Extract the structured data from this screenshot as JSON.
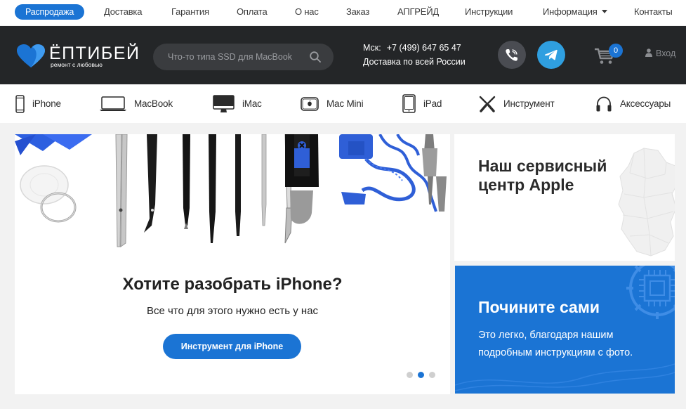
{
  "topnav": {
    "sale": "Распродажа",
    "items": [
      "Доставка",
      "Гарантия",
      "Оплата",
      "О нас",
      "Заказ",
      "АПГРЕЙД",
      "Инструкции",
      "Информация",
      "Контакты"
    ]
  },
  "header": {
    "logo_name": "ЁПТИБЕЙ",
    "logo_slogan": "ремонт с любовью",
    "search_placeholder": "Что-то типа SSD для MacBook",
    "phone_label": "Мск:",
    "phone": "+7 (499) 647 65 47",
    "delivery": "Доставка по всей России",
    "cart_count": "0",
    "login": "Вход"
  },
  "categories": [
    "iPhone",
    "MacBook",
    "iMac",
    "Mac Mini",
    "iPad",
    "Инструмент",
    "Аксессуары"
  ],
  "slider": {
    "title": "Хотите разобрать iPhone?",
    "subtitle": "Все что для этого нужно есть у нас",
    "button": "Инструмент для iPhone",
    "active_slide": 2,
    "total_slides": 3
  },
  "promo1": {
    "title": "Наш сервисный центр Apple"
  },
  "promo2": {
    "title": "Почините сами",
    "text": "Это легко, благодаря нашим подробным инструкциям с фото."
  },
  "colors": {
    "accent": "#1b74d4",
    "header_bg": "#242628",
    "telegram": "#2f9fe0"
  }
}
